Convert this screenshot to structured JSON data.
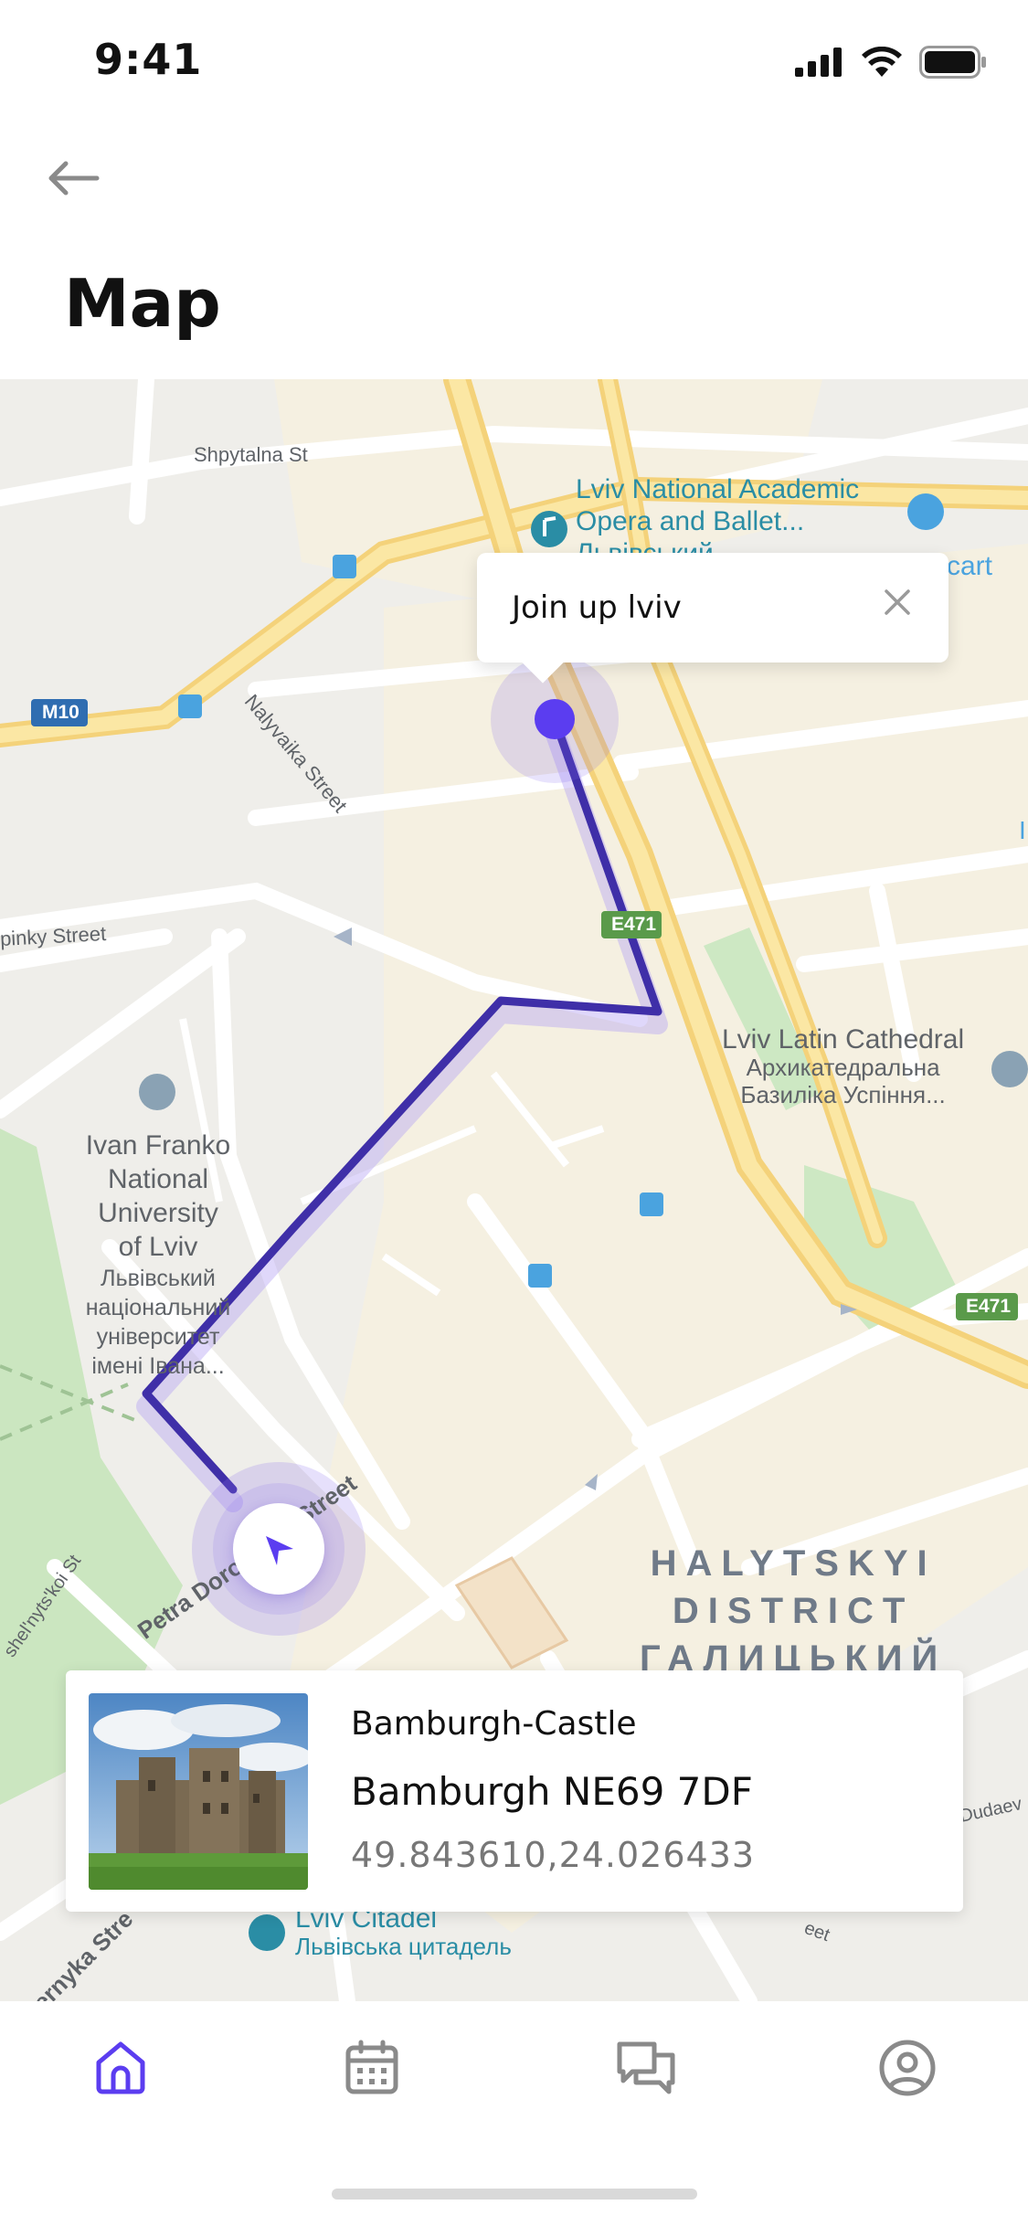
{
  "status_bar": {
    "time": "9:41"
  },
  "header": {
    "title": "Map"
  },
  "map": {
    "streets": {
      "shpytalna": "Shpytalna St",
      "nalyvaika": "Nalyvaika Street",
      "pinky": "pinky Street",
      "petra_dorosh": "Petra Dorosh",
      "street_tail": "Street",
      "shelnytskoi": "shel'nyts'koi St",
      "dudaev": "Dudaev",
      "vernyka": "ernyka Stre",
      "street_small": "eet"
    },
    "pois": {
      "opera_line1": "Lviv National Academic",
      "opera_line2": "Opera and Ballet...",
      "opera_line3": "Львівський",
      "cart": "cart",
      "latin_cathedral": "Lviv Latin Cathedral",
      "latin_cathedral_uk1": "Архикатедральна",
      "latin_cathedral_uk2": "Базиліка Успіння...",
      "university_line1": "Ivan Franko",
      "university_line2": "National",
      "university_line3": "University",
      "university_line4": "of Lviv",
      "university_line5": "Львівський",
      "university_line6": "національний",
      "university_line7": "університет",
      "university_line8": "імені Івана...",
      "citadel": "Lviv Citadel",
      "citadel_uk": "Львівська цитадель",
      "right_edge": "I"
    },
    "district_line1": "HALYTSKYI",
    "district_line2": "DISTRICT",
    "district_line3": "ГАЛИЦЬКИЙ",
    "shields": {
      "m10": "M10",
      "e471_a": "E471",
      "e471_b": "E471"
    },
    "colors": {
      "route": "#3f2fa8",
      "accent": "#6a4cf5",
      "pin": "#5b3df0"
    }
  },
  "popup": {
    "title": "Join up lviv"
  },
  "card": {
    "name": "Bamburgh-Castle",
    "address": "Bamburgh NE69 7DF",
    "coordinates": "49.843610,24.026433"
  },
  "tabs": [
    {
      "icon": "home-icon",
      "active": true
    },
    {
      "icon": "calendar-icon",
      "active": false
    },
    {
      "icon": "chat-icon",
      "active": false
    },
    {
      "icon": "profile-icon",
      "active": false
    }
  ]
}
